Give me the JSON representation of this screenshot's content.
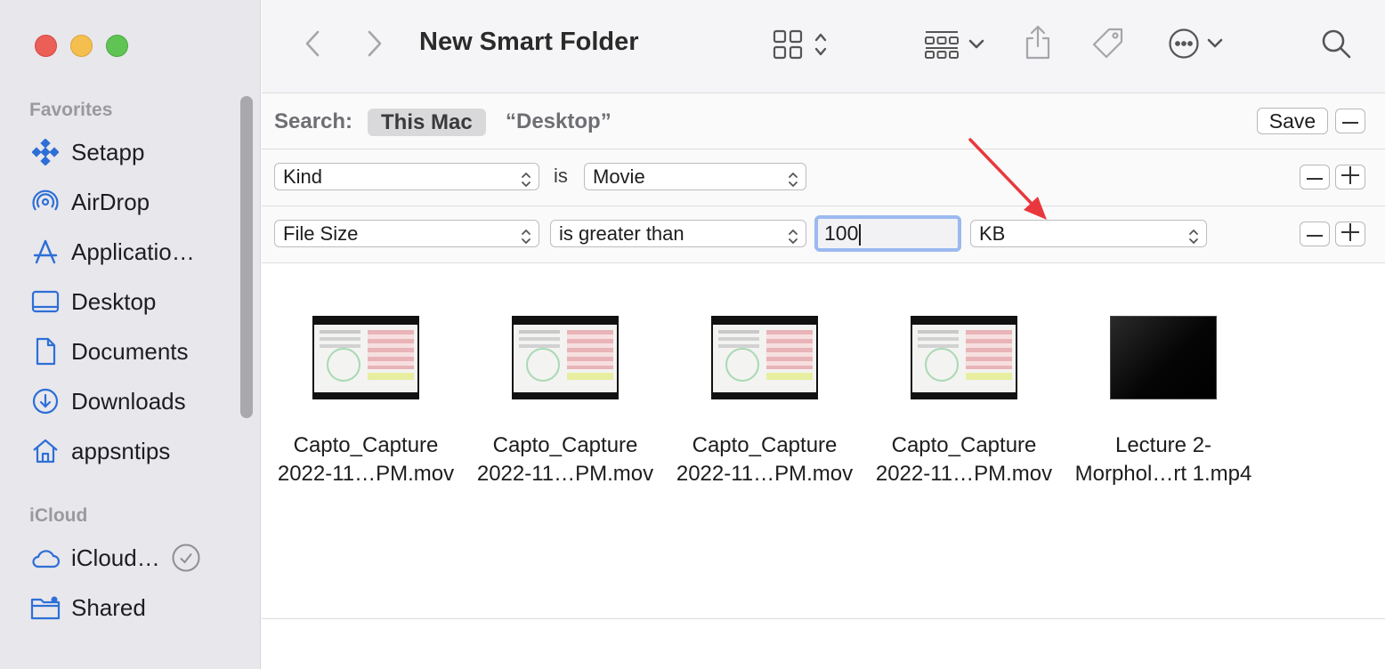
{
  "window": {
    "title": "New Smart Folder"
  },
  "sidebar": {
    "favorites_title": "Favorites",
    "favorites": [
      {
        "label": "Setapp",
        "icon": "setapp-icon"
      },
      {
        "label": "AirDrop",
        "icon": "airdrop-icon"
      },
      {
        "label": "Applicatio…",
        "icon": "applications-icon"
      },
      {
        "label": "Desktop",
        "icon": "desktop-icon"
      },
      {
        "label": "Documents",
        "icon": "document-icon"
      },
      {
        "label": "Downloads",
        "icon": "download-icon"
      },
      {
        "label": "appsntips",
        "icon": "home-icon"
      }
    ],
    "icloud_title": "iCloud",
    "icloud": [
      {
        "label": "iCloud…",
        "icon": "cloud-icon"
      },
      {
        "label": "Shared",
        "icon": "shared-folder-icon"
      }
    ]
  },
  "search": {
    "label": "Search:",
    "scope_selected": "This Mac",
    "scope_other": "“Desktop”",
    "save_label": "Save"
  },
  "criteria": [
    {
      "attribute": "Kind",
      "operator": "is",
      "value": "Movie"
    },
    {
      "attribute": "File Size",
      "operator": "is greater than",
      "value": "100",
      "unit": "KB"
    }
  ],
  "results": [
    {
      "line1": "Capto_Capture",
      "line2": "2022-11…PM.mov"
    },
    {
      "line1": "Capto_Capture",
      "line2": "2022-11…PM.mov"
    },
    {
      "line1": "Capto_Capture",
      "line2": "2022-11…PM.mov"
    },
    {
      "line1": "Capto_Capture",
      "line2": "2022-11…PM.mov"
    },
    {
      "line1": "Lecture 2-",
      "line2": "Morphol…rt 1.mp4"
    }
  ],
  "colors": {
    "accent": "#3478f6",
    "annotation_arrow": "#e8383d"
  }
}
